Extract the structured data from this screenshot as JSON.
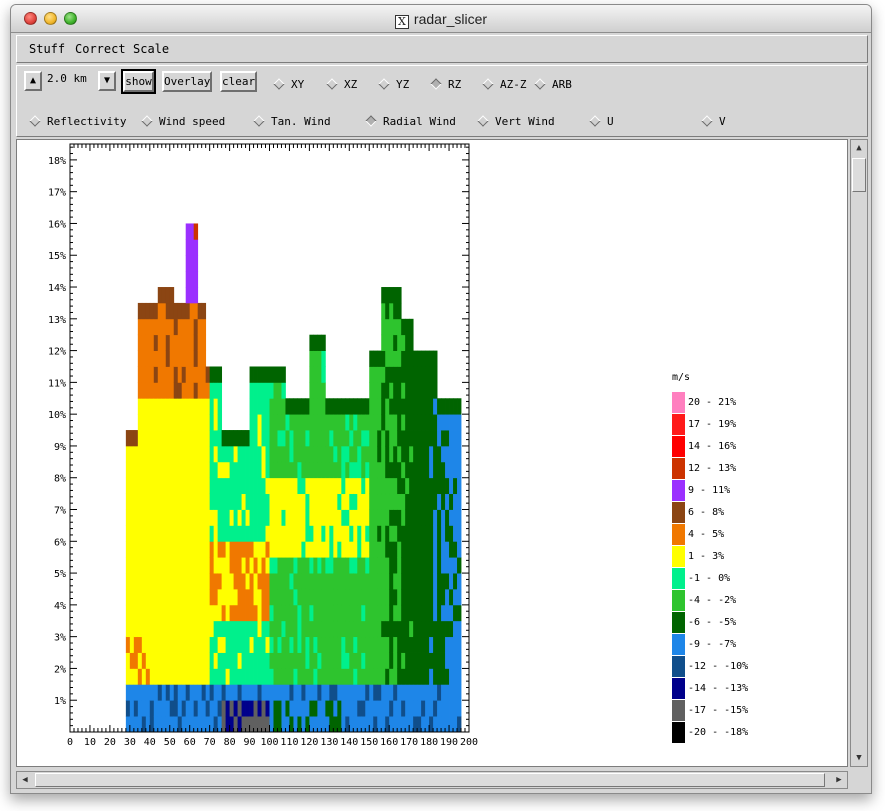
{
  "window": {
    "title": "radar_slicer"
  },
  "menu": {
    "items": [
      "Stuff",
      "Correct",
      "Scale"
    ]
  },
  "toolbar": {
    "height_value": "2.0 km",
    "show_label": "show",
    "overlay_label": "Overlay",
    "clear_label": "clear",
    "views": [
      {
        "label": "XY",
        "selected": false
      },
      {
        "label": "XZ",
        "selected": false
      },
      {
        "label": "YZ",
        "selected": false
      },
      {
        "label": "RZ",
        "selected": true
      },
      {
        "label": "AZ-Z",
        "selected": false
      },
      {
        "label": "ARB",
        "selected": false
      }
    ],
    "fields": [
      {
        "label": "Reflectivity",
        "selected": false
      },
      {
        "label": "Wind speed",
        "selected": false
      },
      {
        "label": "Tan. Wind",
        "selected": false
      },
      {
        "label": "Radial Wind",
        "selected": true
      },
      {
        "label": "Vert Wind",
        "selected": false
      },
      {
        "label": "U",
        "selected": false
      },
      {
        "label": "V",
        "selected": false
      }
    ]
  },
  "chart_data": {
    "type": "heatmap",
    "x_ticks": [
      "0",
      "10",
      "20",
      "30",
      "40",
      "50",
      "60",
      "70",
      "80",
      "90",
      "100",
      "110",
      "120",
      "130",
      "140",
      "150",
      "160",
      "170",
      "180",
      "190",
      "200"
    ],
    "y_ticks": [
      "1%",
      "2%",
      "3%",
      "4%",
      "5%",
      "6%",
      "7%",
      "8%",
      "9%",
      "10%",
      "11%",
      "12%",
      "13%",
      "14%",
      "15%",
      "16%",
      "17%",
      "18%"
    ],
    "xlim": [
      0,
      200
    ],
    "ylim": [
      0,
      18.5
    ],
    "unit": "m/s",
    "legend": [
      {
        "label": "20 - 21%",
        "color": "#ff7fbf"
      },
      {
        "label": "17 - 19%",
        "color": "#ff1a1a"
      },
      {
        "label": "14 - 16%",
        "color": "#ff0000"
      },
      {
        "label": "12 - 13%",
        "color": "#cc3300"
      },
      {
        "label": "9 - 11%",
        "color": "#9b30ff"
      },
      {
        "label": "6 - 8%",
        "color": "#8b4513"
      },
      {
        "label": "4 - 5%",
        "color": "#f07800"
      },
      {
        "label": "1 - 3%",
        "color": "#ffff00"
      },
      {
        "label": "-1 - 0%",
        "color": "#00f08c"
      },
      {
        "label": "-4 - -2%",
        "color": "#2ec42e"
      },
      {
        "label": "-6 - -5%",
        "color": "#006400"
      },
      {
        "label": "-9 - -7%",
        "color": "#1e86e8"
      },
      {
        "label": "-12 - -10%",
        "color": "#104e8b"
      },
      {
        "label": "-14 - -13%",
        "color": "#00008b"
      },
      {
        "label": "-17 - -15%",
        "color": "#606060"
      },
      {
        "label": "-20 - -18%",
        "color": "#000000"
      }
    ]
  }
}
